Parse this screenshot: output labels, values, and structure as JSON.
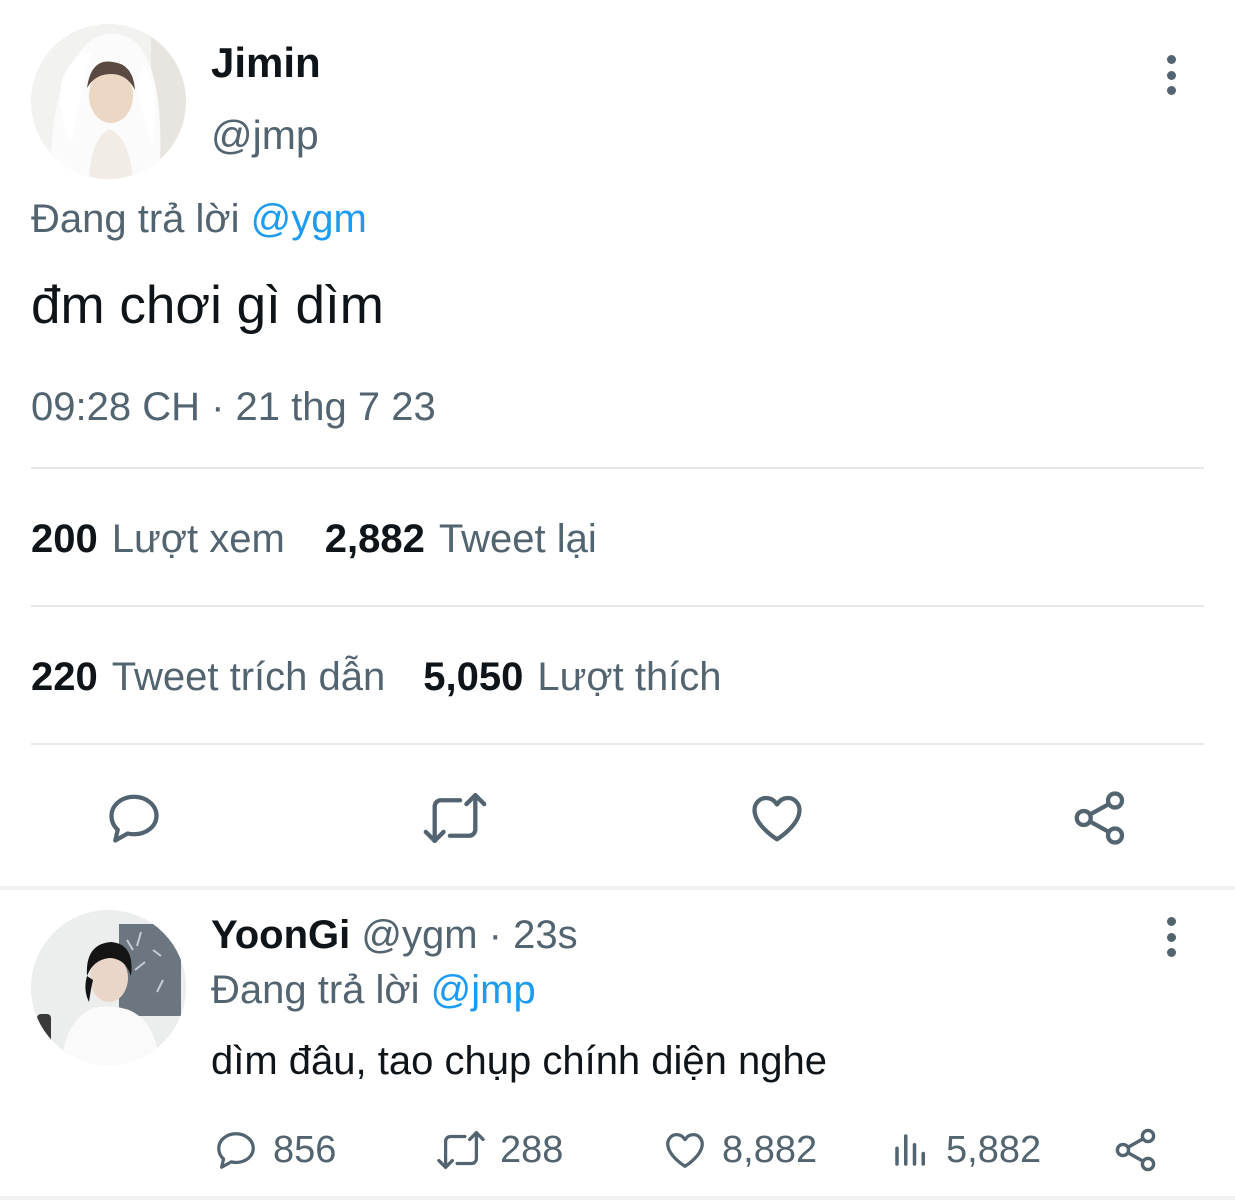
{
  "main_tweet": {
    "author_name": "Jimin",
    "author_handle": "@jmp",
    "reply_prefix": "Đang trả lời",
    "reply_to": "@ygm",
    "text": "đm chơi gì dìm",
    "timestamp": "09:28 CH · 21 thg 7 23",
    "stats_row1": [
      {
        "value": "200",
        "label": "Lượt xem"
      },
      {
        "value": "2,882",
        "label": "Tweet lại"
      }
    ],
    "stats_row2": [
      {
        "value": "220",
        "label": "Tweet trích dẫn"
      },
      {
        "value": "5,050",
        "label": "Lượt thích"
      }
    ],
    "actions": [
      "reply-icon",
      "retweet-icon",
      "like-icon",
      "share-icon"
    ]
  },
  "reply_tweet": {
    "author_name": "YoonGi",
    "author_handle": "@ygm",
    "separator": "·",
    "time_ago": "23s",
    "reply_prefix": "Đang trả lời",
    "reply_to": "@jmp",
    "text": "dìm đâu, tao chụp chính diện nghe",
    "counts": {
      "replies": "856",
      "retweets": "288",
      "likes": "8,882",
      "views": "5,882"
    }
  },
  "colors": {
    "text_primary": "#0f1419",
    "text_secondary": "#536471",
    "link": "#1d9bf0",
    "divider": "#e6e9eb"
  }
}
